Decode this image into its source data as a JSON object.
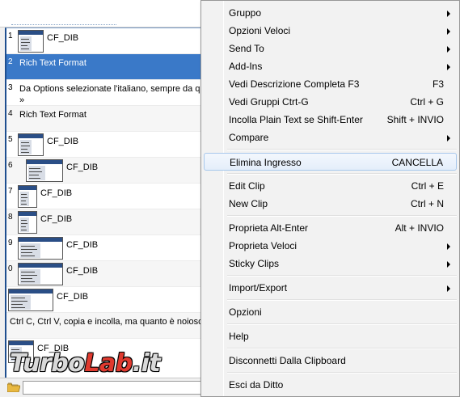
{
  "clip_list": {
    "items": [
      {
        "num": "1",
        "label": "CF_DIB",
        "type": "image"
      },
      {
        "num": "2",
        "text": "Rich Text Format",
        "type": "text",
        "selected": true
      },
      {
        "num": "3",
        "text": "Da Options selezionate l'italiano, sempre da qu",
        "sub": "»",
        "type": "text"
      },
      {
        "num": "4",
        "text": "Rich Text Format",
        "type": "text"
      },
      {
        "num": "5",
        "label": "CF_DIB",
        "type": "image"
      },
      {
        "num": "6",
        "label": "CF_DIB",
        "type": "image"
      },
      {
        "num": "7",
        "label": "CF_DIB",
        "type": "image"
      },
      {
        "num": "8",
        "label": "CF_DIB",
        "type": "image"
      },
      {
        "num": "9",
        "label": "CF_DIB",
        "type": "image"
      },
      {
        "num": "0",
        "label": "CF_DIB",
        "type": "image"
      },
      {
        "num": "",
        "label": "CF_DIB",
        "type": "image"
      },
      {
        "num": "",
        "text": "Ctrl C, Ctrl V, copia e incolla, ma quanto è noioso",
        "type": "text"
      },
      {
        "num": "",
        "label": "CF_DIB",
        "type": "image"
      }
    ]
  },
  "watermark": {
    "part1": "Turbo",
    "part2": "Lab",
    "part3": ".it"
  },
  "menu": {
    "items": [
      {
        "label": "Gruppo",
        "shortcut": "",
        "submenu": true
      },
      {
        "label": "Opzioni Veloci",
        "shortcut": "",
        "submenu": true
      },
      {
        "label": "Send To",
        "shortcut": "",
        "submenu": true
      },
      {
        "label": "Add-Ins",
        "shortcut": "",
        "submenu": true
      },
      {
        "label": "Vedi Descrizione Completa F3",
        "shortcut": "F3",
        "submenu": false
      },
      {
        "label": "Vedi Gruppi Ctrt-G",
        "shortcut": "Ctrl + G",
        "submenu": false
      },
      {
        "label": "Incolla Plain Text se Shift-Enter",
        "shortcut": "Shift + INVIO",
        "submenu": false
      },
      {
        "label": "Compare",
        "shortcut": "",
        "submenu": true
      },
      {
        "label": "Elimina Ingresso",
        "shortcut": "CANCELLA",
        "submenu": false,
        "highlighted": true
      },
      {
        "label": "Edit Clip",
        "shortcut": "Ctrl + E",
        "submenu": false
      },
      {
        "label": "New Clip",
        "shortcut": "Ctrl + N",
        "submenu": false
      },
      {
        "label": "Proprieta Alt-Enter",
        "shortcut": "Alt + INVIO",
        "submenu": false
      },
      {
        "label": "Proprieta Veloci",
        "shortcut": "",
        "submenu": true
      },
      {
        "label": "Sticky Clips",
        "shortcut": "",
        "submenu": true
      },
      {
        "label": "Import/Export",
        "shortcut": "",
        "submenu": true
      },
      {
        "label": "Opzioni",
        "shortcut": "",
        "submenu": false
      },
      {
        "label": "Help",
        "shortcut": "",
        "submenu": false
      },
      {
        "label": "Disconnetti Dalla Clipboard",
        "shortcut": "",
        "submenu": false
      },
      {
        "label": "Esci da Ditto",
        "shortcut": "",
        "submenu": false
      }
    ]
  },
  "colors": {
    "selection": "#3a79c8",
    "menu_background": "#f2f2f2",
    "menu_highlight_border": "#a8c8ec"
  }
}
